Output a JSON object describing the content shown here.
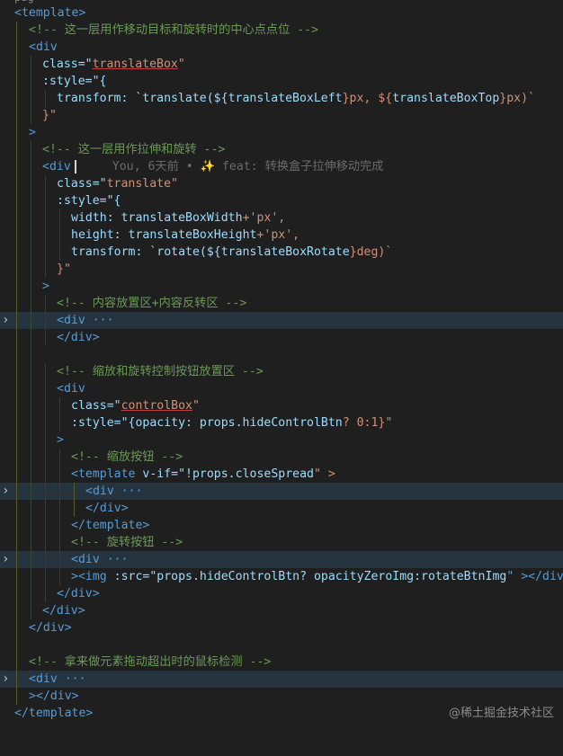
{
  "editor": {
    "cut_top": "pag",
    "lines": {
      "l1": "<template>",
      "l2": "<!-- 这一层用作移动目标和旋转时的中心点点位 -->",
      "l3": "<div",
      "l4a": "class=\"",
      "l4b": "translateBox",
      "l4c": "\"",
      "l5": ":style=\"{",
      "l6a": "transform: `translate(${",
      "l6b": "translateBoxLeft",
      "l6c": "}px, ${",
      "l6d": "translateBoxTop",
      "l6e": "}px)`",
      "l7": "}\"",
      "l8": ">",
      "l9": "<!-- 这一层用作拉伸和旋转 -->",
      "l10": "<div",
      "l10blame": "You, 6天前 • ✨ feat: 转换盒子拉伸移动完成",
      "l11a": "class=\"",
      "l11b": "translate",
      "l11c": "\"",
      "l12": ":style=\"{",
      "l13a": "width: ",
      "l13b": "translateBoxWidth",
      "l13c": "+'px',",
      "l14a": "height: ",
      "l14b": "translateBoxHeight",
      "l14c": "+'px',",
      "l15a": "transform: `rotate(${",
      "l15b": "translateBoxRotate",
      "l15c": "}deg)`",
      "l16": "}\"",
      "l17": ">",
      "l18": "<!-- 内容放置区+内容反转区 -->",
      "l19": "<div ···",
      "l20": "</div>",
      "l21": "",
      "l22": "<!-- 缩放和旋转控制按钮放置区 -->",
      "l23": "<div",
      "l24a": "class=\"",
      "l24b": "controlBox",
      "l24c": "\"",
      "l25a": ":style=\"{opacity: ",
      "l25b": "props.hideControlBtn",
      "l25c": "? 0:1}\"",
      "l26": ">",
      "l27": "<!-- 缩放按钮 -->",
      "l28a": "<template ",
      "l28b": "v-if=\"",
      "l28c": "!props.closeSpread",
      "l28d": "\" >",
      "l29": "<div ···",
      "l30": "</div>",
      "l31": "</template>",
      "l32": "<!-- 旋转按钮 -->",
      "l33": "<div ···",
      "l34a": "><img ",
      "l34b": ":src=\"",
      "l34c": "props.hideControlBtn? opacityZeroImg:rotateBtnImg",
      "l34d": "\" ></div>",
      "l35": "</div>",
      "l36": "</div>",
      "l37": "</div>",
      "l38": "",
      "l39": "<!-- 拿来做元素拖动超出时的鼠标检测 -->",
      "l40": "<div ···",
      "l41": "></div>",
      "l42": "</template>"
    },
    "watermark": "@稀土掘金技术社区"
  }
}
